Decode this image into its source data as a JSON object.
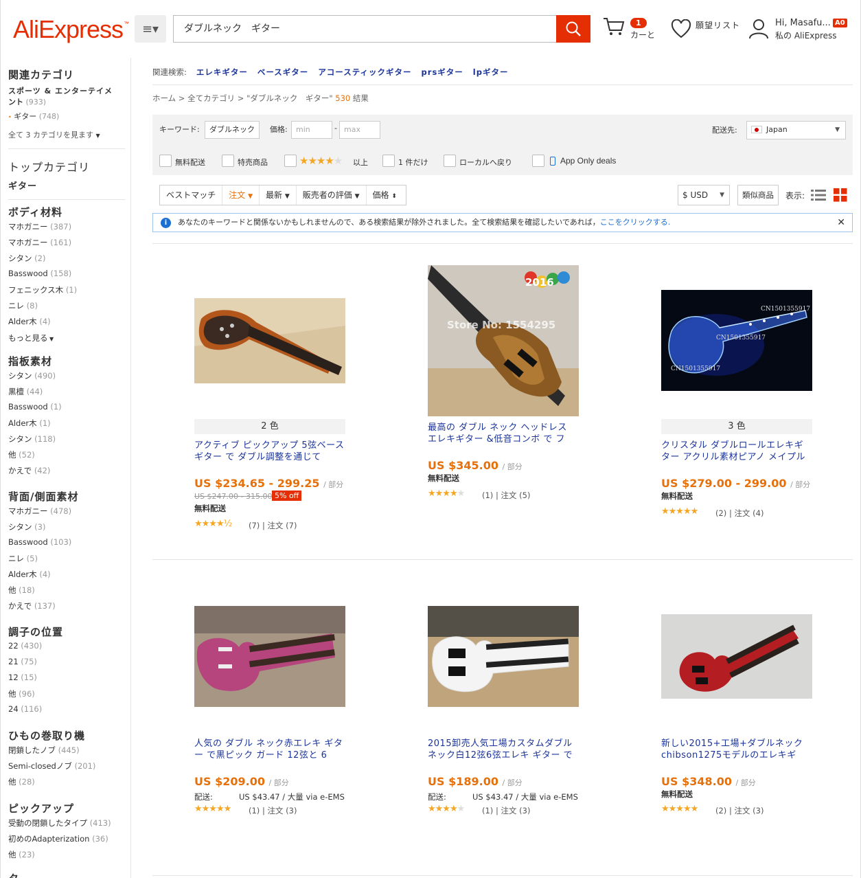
{
  "header": {
    "logo": "AliExpress",
    "logo_tm": "™",
    "search_value": "ダブルネック　ギター",
    "cart_count": "1",
    "cart_label": "カーと",
    "wishlist_label": "願望リスト",
    "greeting": "Hi, Masafu...",
    "account_label": "私の AliExpress",
    "badge": "A0"
  },
  "sidebar": {
    "related_title": "関連カテゴリ",
    "cat1": "スポーツ & エンターテイメ",
    "cat1b": "ント",
    "cat1_count": "(933)",
    "cat2": "ギター",
    "cat2_count": "(748)",
    "see_all": "全て 3 カテゴリを見ます",
    "top_title": "トップカテゴリ",
    "top_item": "ギター",
    "groups": [
      {
        "title": "ボディ材料",
        "items": [
          [
            "マホガニー",
            "(387)"
          ],
          [
            "マホガニー",
            "(161)"
          ],
          [
            "シタン",
            "(2)"
          ],
          [
            "Basswood",
            "(158)"
          ],
          [
            "フェニックス木",
            "(1)"
          ],
          [
            "ニレ",
            "(8)"
          ],
          [
            "Alder木",
            "(4)"
          ]
        ],
        "more": "もっと見る"
      },
      {
        "title": "指板素材",
        "items": [
          [
            "シタン",
            "(490)"
          ],
          [
            "黒檀",
            "(44)"
          ],
          [
            "Basswood",
            "(1)"
          ],
          [
            "Alder木",
            "(1)"
          ],
          [
            "シタン",
            "(118)"
          ],
          [
            "他",
            "(52)"
          ],
          [
            "かえで",
            "(42)"
          ]
        ]
      },
      {
        "title": "背面/側面素材",
        "items": [
          [
            "マホガニー",
            "(478)"
          ],
          [
            "シタン",
            "(3)"
          ],
          [
            "Basswood",
            "(103)"
          ],
          [
            "ニレ",
            "(5)"
          ],
          [
            "Alder木",
            "(4)"
          ],
          [
            "他",
            "(18)"
          ],
          [
            "かえで",
            "(137)"
          ]
        ]
      },
      {
        "title": "調子の位置",
        "items": [
          [
            "22",
            "(430)"
          ],
          [
            "21",
            "(75)"
          ],
          [
            "12",
            "(15)"
          ],
          [
            "他",
            "(96)"
          ],
          [
            "24",
            "(116)"
          ]
        ]
      },
      {
        "title": "ひもの巻取り機",
        "items": [
          [
            "閉鎖したノブ",
            "(445)"
          ],
          [
            "Semi-closedノブ",
            "(201)"
          ],
          [
            "他",
            "(28)"
          ]
        ]
      },
      {
        "title": "ピックアップ",
        "items": [
          [
            "受動の閉鎖したタイプ",
            "(413)"
          ],
          [
            "初めのAdapterization",
            "(36)"
          ],
          [
            "他",
            "(23)"
          ]
        ]
      }
    ],
    "cut_title": "タ"
  },
  "related": {
    "label": "関連検索:",
    "links": [
      "エレキギター",
      "ベースギター",
      "アコースティックギター",
      "prsギター",
      "lpギター"
    ]
  },
  "breadcrumb": {
    "home": "ホーム",
    "all": "全てカテゴリ",
    "query": "\"ダブルネック　ギター\"",
    "count": "530",
    "suffix": "結果"
  },
  "filters": {
    "keyword_label": "キーワード:",
    "keyword_value": "ダブルネック",
    "price_label": "価格:",
    "min_placeholder": "min",
    "max_placeholder": "max",
    "ship_to_label": "配送先:",
    "ship_to_value": "Japan",
    "free_shipping": "無料配送",
    "sale": "特売商品",
    "rating_suffix": "以上",
    "one_piece": "1 件だけ",
    "local_return": "ローカルへ戻り",
    "app_only": "App Only deals"
  },
  "sort": {
    "best": "ベストマッチ",
    "orders": "注文",
    "newest": "最新",
    "seller_rating": "販売者の評価",
    "price": "価格",
    "currency": "$ USD",
    "similar": "類似商品",
    "view_label": "表示:"
  },
  "notice": {
    "text": "あなたのキーワードと関係ないかもしれませんので、ある検索結果が除外されました。全て検索結果を確認したいであれば，",
    "link": "ここをクリックする."
  },
  "products": [
    {
      "colors": "2 色",
      "title": "アクティブ ピックアップ 5弦ベース ギター で ダブル調整を通じて",
      "price": "US $234.65 - 299.25",
      "unit": "/ 部分",
      "old_price": "US $247.00 - 315.00",
      "discount": "5% off",
      "shipping": "無料配送",
      "stars": "★★★★½",
      "rating": 4.5,
      "reviews": "(7)",
      "orders": "注文 (7)"
    },
    {
      "title": "最高の ダブル ネック ヘッドレス エレキギター &低音コンボ で フ",
      "price": "US $345.00",
      "unit": "/ 部分",
      "shipping": "無料配送",
      "stars": "★★★★☆",
      "rating": 4,
      "reviews": "(1)",
      "orders": "注文 (5)"
    },
    {
      "colors": "3 色",
      "title": "クリスタル ダブルロールエレキギター アクリル素材ピアノ メイプル",
      "price": "US $279.00 - 299.00",
      "unit": "/ 部分",
      "shipping": "無料配送",
      "stars": "★★★★★",
      "rating": 5,
      "reviews": "(2)",
      "orders": "注文 (4)"
    },
    {
      "title": "人気の ダブル ネック赤エレキ ギター で黒ピック ガード 12弦と 6",
      "price": "US $209.00",
      "unit": "/ 部分",
      "ship_label": "配送:",
      "ship_value": "US $43.47 / 大量 via e-EMS",
      "stars": "★★★★★",
      "rating": 5,
      "reviews": "(1)",
      "orders": "注文 (3)"
    },
    {
      "title": "2015卸売人気工場カスタムダブルネック白12弦6弦エレキ ギター で",
      "price": "US $189.00",
      "unit": "/ 部分",
      "ship_label": "配送:",
      "ship_value": "US $43.47 / 大量 via e-EMS",
      "stars": "★★★★☆",
      "rating": 4,
      "reviews": "(1)",
      "orders": "注文 (3)"
    },
    {
      "title": "新しい2015+工場+ダブルネックchibson1275モデルのエレキギ",
      "price": "US $348.00",
      "unit": "/ 部分",
      "shipping": "無料配送",
      "stars": "★★★★★",
      "rating": 5,
      "reviews": "(2)",
      "orders": "注文 (3)"
    }
  ],
  "image_text": {
    "store": "Store No: 1554295",
    "year": "2016",
    "wm": "CN1501355917"
  }
}
